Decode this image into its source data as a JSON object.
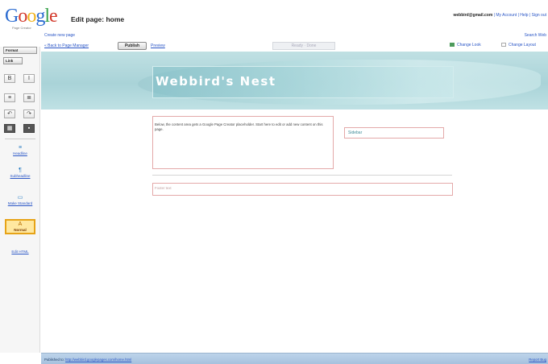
{
  "logo": {
    "letters": [
      "G",
      "o",
      "o",
      "g",
      "l",
      "e"
    ],
    "subtitle": "Page Creator"
  },
  "header": {
    "page_heading": "Edit page: home",
    "account_email": "webbird@gmail.com",
    "account_links": "| My Account | Help | Sign out"
  },
  "subbar": {
    "create_link": "Create new page",
    "search_link": "Search Web"
  },
  "toolbar": {
    "back_link": "« Back to Page Manager",
    "publish_label": "Publish",
    "preview_link": "Preview",
    "status_text": "Ready · Done",
    "layout_link": "Change Look",
    "color_link": "Change Layout"
  },
  "leftbar": {
    "format_button": "Format",
    "link_button": "Link",
    "items": [
      {
        "glyph": "≡",
        "label": "Headline"
      },
      {
        "glyph": "¶",
        "label": "Subheadline"
      },
      {
        "glyph": "▭",
        "label": "Make Standard"
      },
      {
        "glyph": "A",
        "label": "Normal"
      }
    ],
    "edit_html": "Edit HTML",
    "tool_icons": [
      "B",
      "I",
      "≡",
      "≣",
      "↶",
      "↷",
      "▦",
      "▪"
    ]
  },
  "canvas": {
    "site_title": "Webbird's Nest",
    "main_text": "Below, the content area gets a Google Page Creator placeholder. Start here to edit or add new content on this page.",
    "side_text": "Sidebar",
    "footer_text": "Footer text"
  },
  "statusbar": {
    "published_prefix": "Published to:",
    "published_url": "http://webbird.googlepages.com/home.html",
    "right_link": "Report Bug"
  },
  "colors": {
    "brand_blue": "#2a6bd1",
    "link_blue": "#2a56c6",
    "banner_teal": "#a9d3d8",
    "active_highlight": "#e6a317"
  }
}
